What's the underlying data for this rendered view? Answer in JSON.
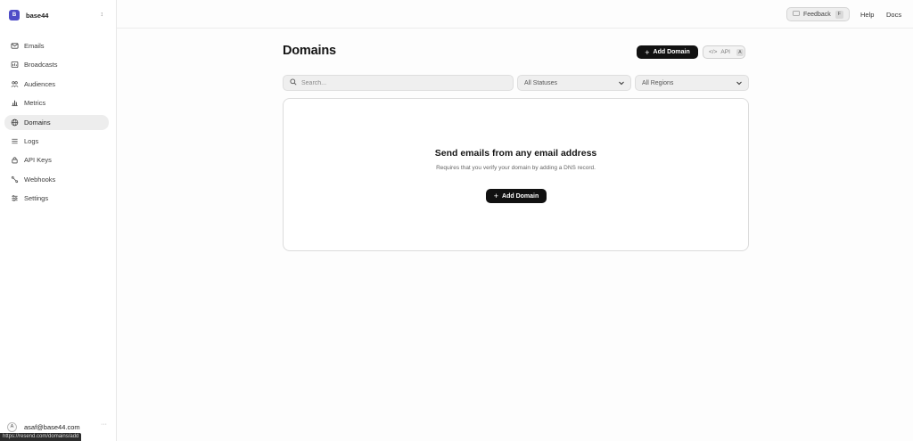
{
  "team": {
    "initial": "B",
    "name": "base44",
    "switch_icon": "chevron-up-down-icon"
  },
  "nav": [
    {
      "label": "Emails",
      "icon": "mail-icon",
      "active": false
    },
    {
      "label": "Broadcasts",
      "icon": "broadcast-icon",
      "active": false
    },
    {
      "label": "Audiences",
      "icon": "audience-icon",
      "active": false
    },
    {
      "label": "Metrics",
      "icon": "chart-icon",
      "active": false
    },
    {
      "label": "Domains",
      "icon": "globe-icon",
      "active": true
    },
    {
      "label": "Logs",
      "icon": "list-icon",
      "active": false
    },
    {
      "label": "API Keys",
      "icon": "lock-icon",
      "active": false
    },
    {
      "label": "Webhooks",
      "icon": "webhook-icon",
      "active": false
    },
    {
      "label": "Settings",
      "icon": "sliders-icon",
      "active": false
    }
  ],
  "user": {
    "initial": "A",
    "email": "asaf@base44.com",
    "more": "···"
  },
  "status_url": "https://resend.com/domains/add",
  "topbar": {
    "feedback_label": "Feedback",
    "feedback_key": "F",
    "help_label": "Help",
    "docs_label": "Docs"
  },
  "page": {
    "title": "Domains",
    "add_domain_label": "Add Domain",
    "api_label": "API",
    "api_key": "A",
    "search_placeholder": "Search...",
    "status_filter": "All Statuses",
    "region_filter": "All Regions"
  },
  "empty": {
    "title": "Send emails from any email address",
    "subtitle": "Requires that you verify your domain by adding a DNS record.",
    "button_label": "Add Domain"
  },
  "colors": {
    "accent": "#4f4dc7",
    "primary_button": "#111111",
    "active_nav": "#ededed"
  }
}
